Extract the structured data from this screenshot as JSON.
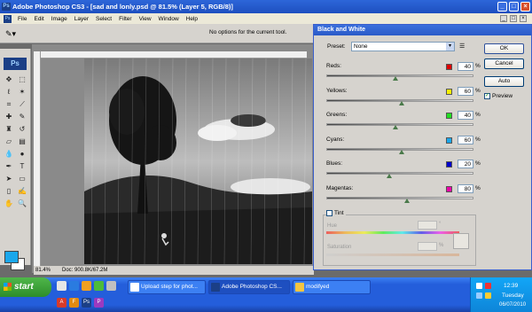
{
  "window": {
    "title": "Adobe Photoshop CS3 - [sad and lonly.psd @ 81.5% (Layer 5, RGB/8)]",
    "app_icon": "Ps"
  },
  "menu": [
    "File",
    "Edit",
    "Image",
    "Layer",
    "Select",
    "Filter",
    "View",
    "Window",
    "Help"
  ],
  "options_bar": {
    "notice": "No options for the current tool."
  },
  "tools_panel": {
    "logo": "Ps",
    "foreground_color": "#1aa7ec",
    "background_color": "#ffffff"
  },
  "document": {
    "zoom": "81.4%",
    "doc_info": "Doc: 900.8K/67.2M"
  },
  "dialog": {
    "title": "Black and White",
    "preset_label": "Preset:",
    "preset_value": "None",
    "buttons": {
      "ok": "OK",
      "cancel": "Cancel",
      "auto": "Auto"
    },
    "preview_label": "Preview",
    "preview_checked": true,
    "sliders": [
      {
        "name": "Reds:",
        "value": "40",
        "color": "#e00000",
        "level": 0.47
      },
      {
        "name": "Yellows:",
        "value": "60",
        "color": "#f8f000",
        "level": 0.51
      },
      {
        "name": "Greens:",
        "value": "40",
        "color": "#22dd22",
        "level": 0.47
      },
      {
        "name": "Cyans:",
        "value": "60",
        "color": "#1aa7ec",
        "level": 0.51
      },
      {
        "name": "Blues:",
        "value": "20",
        "color": "#0000cc",
        "level": 0.43
      },
      {
        "name": "Magentas:",
        "value": "80",
        "color": "#ee00aa",
        "level": 0.55
      }
    ],
    "percent_unit": "%",
    "tint": {
      "label": "Tint",
      "checked": false,
      "hue_label": "Hue",
      "hue_unit": "°",
      "saturation_label": "Saturation",
      "saturation_unit": "%"
    }
  },
  "taskbar": {
    "start_label": "start",
    "tasks": [
      {
        "label": "Upload step for phot...",
        "icon_color": "#ffffff",
        "active": false
      },
      {
        "label": "Adobe Photoshop CS...",
        "icon_color": "#1b3f86",
        "active": true
      },
      {
        "label": "modifyed",
        "icon_color": "#f4c542",
        "active": false
      }
    ],
    "clock": {
      "time": "12:39",
      "day": "Tuesday",
      "date": "06/07/2010"
    }
  }
}
